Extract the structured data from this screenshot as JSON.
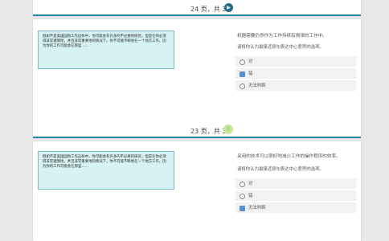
{
  "top_page": {
    "counter": "24 页，共 30",
    "nav_icon": "play-icon"
  },
  "q1": {
    "passage": "假如不是美国国防工作这样中，你可能会有许多的不必要的研究，但是在你必须得非常谨慎地，并且非常重要地的情况下，你不可能不断地在一个地方工作，因为你的工作可能会在那里……",
    "question": "机器需要仍然作为工作持续有规律的工作中。",
    "instruction": "请将你认为最接近原句表达中心意思的选项。",
    "options": [
      {
        "label": "对",
        "checked": false
      },
      {
        "label": "错",
        "checked": true
      },
      {
        "label": "无法判断",
        "checked": false
      }
    ],
    "counter": "23 页，共 30"
  },
  "q2": {
    "passage": "假如不是美国国防工作这样中，你可能会有许多的不必要的研究，但是在你必须得非常谨慎地，并且非常重要地的情况下，你不可能不断地在一个地方工作，因为你的工作可能会在那里……",
    "question": "采用的技术可以很好地减少工作的操作程序的效率。",
    "instruction": "请将你认为最接近原句表达中心意思的选项。",
    "options": [
      {
        "label": "对",
        "checked": false
      },
      {
        "label": "错",
        "checked": false
      },
      {
        "label": "无法判断",
        "checked": true
      }
    ]
  },
  "colors": {
    "accent": "#2e8aa0",
    "passage_bg": "#d6f2f2",
    "checked": "#5b8fd4"
  }
}
